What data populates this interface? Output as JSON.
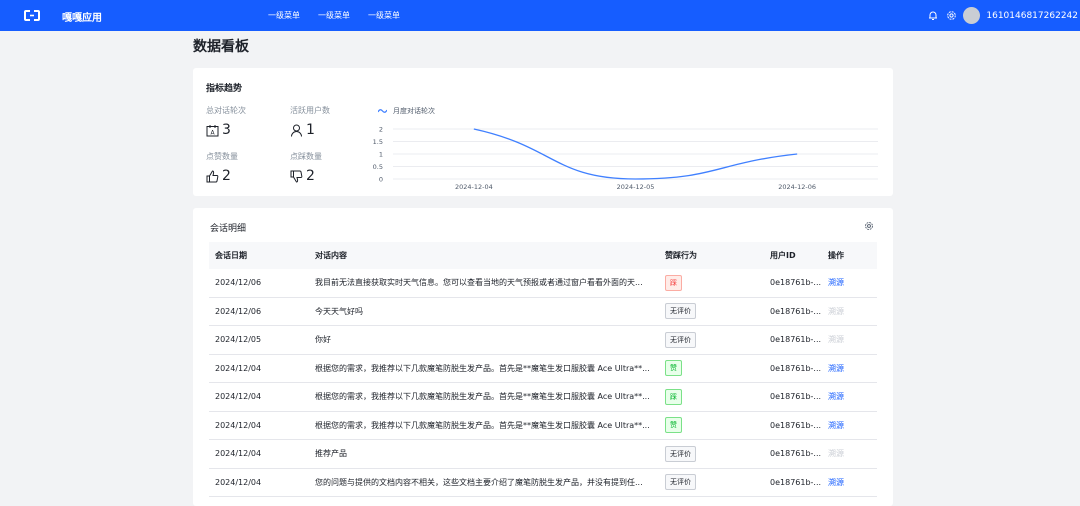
{
  "header": {
    "app_title": "嘎嘎应用",
    "menu": [
      "一级菜单",
      "一级菜单",
      "一级菜单"
    ],
    "user_id": "1610146817262242"
  },
  "page_title": "数据看板",
  "metrics_card": {
    "title": "指标趋势",
    "metrics": [
      {
        "label": "总对话轮次",
        "value": "3",
        "icon": "calendar-icon"
      },
      {
        "label": "活跃用户数",
        "value": "1",
        "icon": "user-icon"
      },
      {
        "label": "点赞数量",
        "value": "2",
        "icon": "thumb-up-icon"
      },
      {
        "label": "点踩数量",
        "value": "2",
        "icon": "thumb-down-icon"
      }
    ]
  },
  "chart_data": {
    "type": "line",
    "title": "",
    "xlabel": "",
    "ylabel": "",
    "x": [
      "2024-12-04",
      "2024-12-05",
      "2024-12-06"
    ],
    "series": [
      {
        "name": "月度对话轮次",
        "values": [
          2,
          0,
          1
        ]
      }
    ],
    "yticks": [
      "0",
      "0.5",
      "1",
      "1.5",
      "2"
    ],
    "ylim": [
      0,
      2
    ],
    "grid": true,
    "line_color": "#4080ff",
    "legend_position": "top-left"
  },
  "detail_card": {
    "title": "会话明细",
    "columns": [
      "会话日期",
      "对话内容",
      "赞踩行为",
      "用户ID",
      "操作"
    ],
    "rows": [
      {
        "date": "2024/12/06",
        "content": "我目前无法直接获取实时天气信息。您可以查看当地的天气预报或者通过窗户看看外面的天...",
        "feedback": "踩",
        "tag": "red",
        "uid": "0e18761b-...",
        "action": "溯源",
        "action_enabled": true
      },
      {
        "date": "2024/12/06",
        "content": "今天天气好吗",
        "feedback": "无评价",
        "tag": "gray",
        "uid": "0e18761b-...",
        "action": "溯源",
        "action_enabled": false
      },
      {
        "date": "2024/12/05",
        "content": "你好",
        "feedback": "无评价",
        "tag": "gray",
        "uid": "0e18761b-...",
        "action": "溯源",
        "action_enabled": false
      },
      {
        "date": "2024/12/04",
        "content": "根据您的需求，我推荐以下几款魔笔防脱生发产品。首先是**魔笔生发口服胶囊 Ace Ultra**...",
        "feedback": "赞",
        "tag": "green",
        "uid": "0e18761b-...",
        "action": "溯源",
        "action_enabled": true
      },
      {
        "date": "2024/12/04",
        "content": "根据您的需求，我推荐以下几款魔笔防脱生发产品。首先是**魔笔生发口服胶囊 Ace Ultra**...",
        "feedback": "踩",
        "tag": "green",
        "uid": "0e18761b-...",
        "action": "溯源",
        "action_enabled": true
      },
      {
        "date": "2024/12/04",
        "content": "根据您的需求，我推荐以下几款魔笔防脱生发产品。首先是**魔笔生发口服胶囊 Ace Ultra**...",
        "feedback": "赞",
        "tag": "green",
        "uid": "0e18761b-...",
        "action": "溯源",
        "action_enabled": true
      },
      {
        "date": "2024/12/04",
        "content": "推荐产品",
        "feedback": "无评价",
        "tag": "gray",
        "uid": "0e18761b-...",
        "action": "溯源",
        "action_enabled": false
      },
      {
        "date": "2024/12/04",
        "content": "您的问题与提供的文档内容不相关，这些文档主要介绍了魔笔防脱生发产品，并没有提到任...",
        "feedback": "无评价",
        "tag": "gray",
        "uid": "0e18761b-...",
        "action": "溯源",
        "action_enabled": true
      }
    ]
  }
}
